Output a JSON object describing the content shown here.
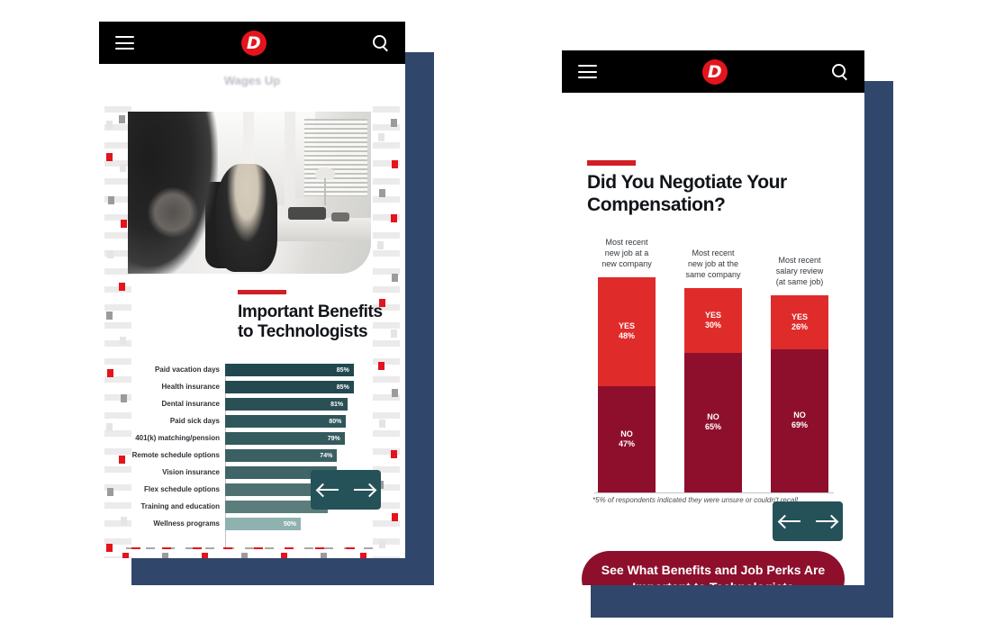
{
  "colors": {
    "backing_navy": "#31466b",
    "brand_red": "#e3141b",
    "accent_rule_red": "#d21e26",
    "bar_teal_dark": "#21474f",
    "bar_teal_light": "#8fb2b0",
    "nav_teal": "#255159",
    "yes_red": "#e02b2b",
    "no_maroon": "#8e0f2c",
    "topbar_black": "#000000"
  },
  "left_device": {
    "topbar": {
      "menu_icon": "hamburger-icon",
      "logo_letter": "D",
      "logo_icon": "dice-logo-icon",
      "search_icon": "search-icon"
    },
    "ghost_text": "Wages Up",
    "photo": {
      "alt": "black and white office photo of two coworkers talking"
    },
    "infographic": {
      "title": "Important Benefits to Technologists"
    },
    "nav": {
      "prev_icon": "arrow-left-icon",
      "next_icon": "arrow-right-icon"
    }
  },
  "right_device": {
    "topbar": {
      "menu_icon": "hamburger-icon",
      "logo_letter": "D",
      "logo_icon": "dice-logo-icon",
      "search_icon": "search-icon"
    },
    "infographic": {
      "title": "Did You Negotiate Your Compensation?",
      "footnote": "*5% of respondents indicated they were unsure or couldn't recall."
    },
    "cta": {
      "label": "See What Benefits and Job Perks Are Important to Technologists"
    },
    "nav": {
      "prev_icon": "arrow-left-icon",
      "next_icon": "arrow-right-icon"
    }
  },
  "chart_data": [
    {
      "type": "bar",
      "orientation": "horizontal",
      "title": "Important Benefits to Technologists",
      "xlabel": "",
      "ylabel": "",
      "xlim": [
        0,
        100
      ],
      "grid": false,
      "legend": "none",
      "categories": [
        "Paid vacation days",
        "Health insurance",
        "Dental insurance",
        "Paid sick days",
        "401(k) matching/pension",
        "Remote schedule options",
        "Vision insurance",
        "Flex schedule options",
        "Training and education",
        "Wellness programs"
      ],
      "values": [
        85,
        85,
        81,
        80,
        79,
        74,
        74,
        70,
        68,
        50
      ],
      "value_labels": [
        "85%",
        "85%",
        "81%",
        "80%",
        "79%",
        "74%",
        "74%",
        "",
        "",
        "50%"
      ],
      "note": "Two lower bars' value labels are covered by the carousel arrows overlay"
    },
    {
      "type": "bar",
      "orientation": "vertical",
      "stacked": true,
      "title": "Did You Negotiate Your Compensation?",
      "xlabel": "",
      "ylabel": "",
      "ylim": [
        0,
        100
      ],
      "grid": false,
      "legend": "none",
      "footnote": "*5% of respondents indicated they were unsure or couldn't recall.",
      "categories": [
        "Most recent\nnew job at a\nnew company",
        "Most recent\nnew job at the\nsame company",
        "Most recent\nsalary review\n(at same job)"
      ],
      "series": [
        {
          "name": "YES",
          "values": [
            48,
            30,
            26
          ],
          "labels": [
            "48%",
            "30%",
            "26%"
          ]
        },
        {
          "name": "NO",
          "values": [
            47,
            65,
            69
          ],
          "labels": [
            "47%",
            "65%",
            "69%"
          ]
        }
      ]
    }
  ]
}
